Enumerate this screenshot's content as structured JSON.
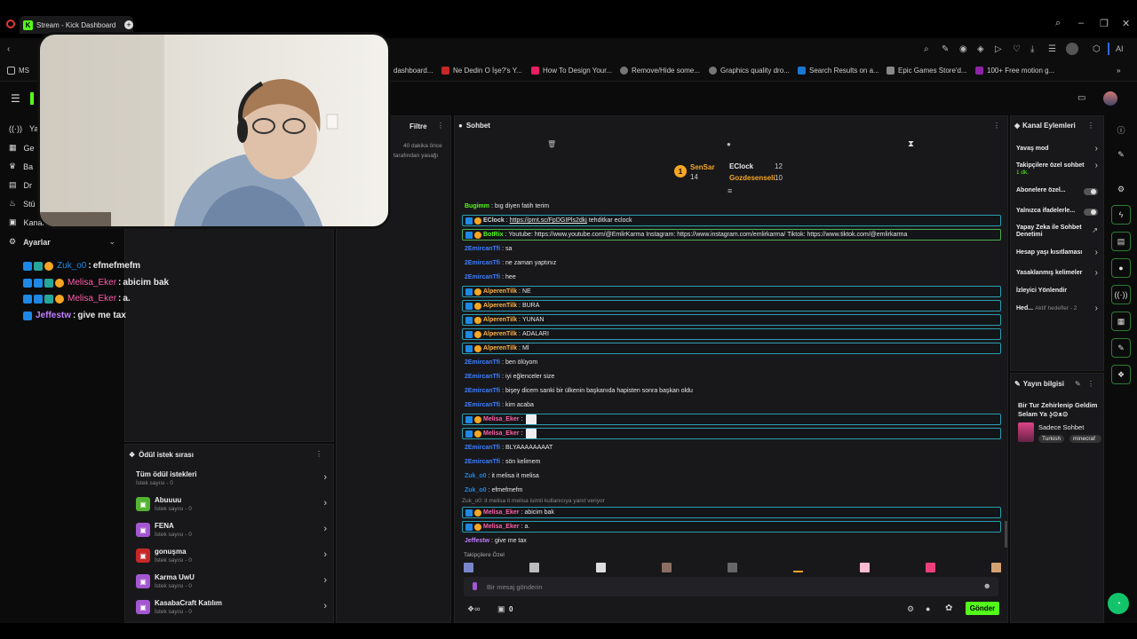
{
  "browser": {
    "tab_title": "Stream - Kick Dashboard",
    "ai_label": "AI"
  },
  "bookmarks": [
    "MS",
    "dashboard...",
    "Ne Dedin O İşe?'s Y...",
    "How To Design Your...",
    "Remove/Hide some...",
    "Graphics quality dro...",
    "Search Results on a...",
    "Epic Games Store'd...",
    "100+ Free motion g..."
  ],
  "left_nav": {
    "items": [
      "Ya",
      "Ge",
      "Ba",
      "Dr",
      "Stü",
      "Kanal"
    ],
    "settings": "Ayarlar"
  },
  "overlay": [
    {
      "user": "Zuk_o0",
      "text": "efmefmefm",
      "color": "#1e88e5"
    },
    {
      "user": "Melisa_Eker",
      "text": "abicim bak",
      "color": "#ff5ea8"
    },
    {
      "user": "Melisa_Eker",
      "text": "a.",
      "color": "#ff5ea8"
    },
    {
      "user": "Jeffestw",
      "text": "give me tax",
      "color": "#c27cff"
    }
  ],
  "filter": {
    "title": "Filtre",
    "time": "40 dakika önce",
    "note": "tarafından yasağı"
  },
  "reward": {
    "title": "Ödül istek sırası",
    "items": [
      {
        "name": "Tüm ödül istekleri",
        "sub": "İstek sayısı - 0",
        "color": ""
      },
      {
        "name": "Abuuuu",
        "sub": "İstek sayısı - 0",
        "color": "#53b332"
      },
      {
        "name": "FENA",
        "sub": "İstek sayısı - 0",
        "color": "#a457d1"
      },
      {
        "name": "gonuşma",
        "sub": "İstek sayısı - 0",
        "color": "#c62828"
      },
      {
        "name": "Karma UwU",
        "sub": "İstek sayısı - 0",
        "color": "#a457d1"
      },
      {
        "name": "KasabaCraft Katılım",
        "sub": "İstek sayısı - 0",
        "color": "#a457d1"
      }
    ]
  },
  "chat": {
    "title": "Sohbet",
    "leaders": [
      {
        "name": "SenSar",
        "count": "14"
      },
      {
        "name": "EClock",
        "count": "12"
      },
      {
        "name": "Gozdesenseli",
        "count": "10"
      }
    ],
    "messages": [
      {
        "user": "Bugimm",
        "text": "bıg diyen fatih terim",
        "color": "#53fc18",
        "style": ""
      },
      {
        "user": "EClock",
        "text": "tehditkar eclock",
        "link": "https://prnt.sc/FpDGIPls2dkj",
        "color": "#d9d9d9",
        "style": "box"
      },
      {
        "user": "BotRix",
        "text": "Youtube: https://www.youtube.com/@EmlirKarma Instagram: https://www.instagram.com/emlirkarma/ Tiktok: https://www.tiktok.com/@emlirkarma",
        "color": "#53fc18",
        "style": "green"
      },
      {
        "user": "2EmircanTfi",
        "text": "sa",
        "color": "#3d7fff",
        "style": ""
      },
      {
        "user": "2EmircanTfi",
        "text": "ne zaman yaptınız",
        "color": "#3d7fff",
        "style": ""
      },
      {
        "user": "2EmircanTfi",
        "text": "hee",
        "color": "#3d7fff",
        "style": ""
      },
      {
        "user": "AlperenTilk",
        "text": "NE",
        "color": "#ffb347",
        "style": "box"
      },
      {
        "user": "AlperenTilk",
        "text": "BURA",
        "color": "#ffb347",
        "style": "box"
      },
      {
        "user": "AlperenTilk",
        "text": "YUNAN",
        "color": "#ffb347",
        "style": "box"
      },
      {
        "user": "AlperenTilk",
        "text": "ADALARI",
        "color": "#ffb347",
        "style": "box"
      },
      {
        "user": "AlperenTilk",
        "text": "Mİ",
        "color": "#ffb347",
        "style": "box"
      },
      {
        "user": "2EmircanTfi",
        "text": "ben ölüyom",
        "color": "#3d7fff",
        "style": ""
      },
      {
        "user": "2EmircanTfi",
        "text": "iyi eğlenceler size",
        "color": "#3d7fff",
        "style": ""
      },
      {
        "user": "2EmircanTfi",
        "text": "bişey dicem sanki bir ülkenin başkanıda hapisten sonra başkan oldu",
        "color": "#3d7fff",
        "style": ""
      },
      {
        "user": "2EmircanTfi",
        "text": "kim acaba",
        "color": "#3d7fff",
        "style": ""
      },
      {
        "user": "Melisa_Eker",
        "text": "",
        "color": "#ff5ea8",
        "style": "box"
      },
      {
        "user": "Melisa_Eker",
        "text": "",
        "color": "#ff5ea8",
        "style": "box"
      },
      {
        "user": "2EmircanTfi",
        "text": "BLYAAAAAAAAT",
        "color": "#3d7fff",
        "style": ""
      },
      {
        "user": "2EmircanTfi",
        "text": "sön kelimem",
        "color": "#3d7fff",
        "style": ""
      },
      {
        "user": "Zuk_o0",
        "text": "it melisa it melisa",
        "color": "#1e88e5",
        "style": ""
      },
      {
        "user": "Zuk_o0",
        "text": "efmefmefm",
        "color": "#1e88e5",
        "style": ""
      }
    ],
    "reply_hint": "Zuk_o0: it melisa it melisa isimli kullanıcıya yanıt veriyor",
    "tail": [
      {
        "user": "Melisa_Eker",
        "text": "abicim bak",
        "color": "#ff5ea8",
        "style": "box"
      },
      {
        "user": "Melisa_Eker",
        "text": "a.",
        "color": "#ff5ea8",
        "style": "box"
      },
      {
        "user": "Jeffestw",
        "text": "give me tax",
        "color": "#c27cff",
        "style": ""
      }
    ],
    "emote_label": "Takipçilere Özel",
    "input_placeholder": "Bir mesaj gönderin",
    "counter": "0",
    "send": "Gönder"
  },
  "channel": {
    "title": "Kanal Eylemleri",
    "items": [
      {
        "label": "Yavaş mod",
        "kind": "arrow",
        "sub": ""
      },
      {
        "label": "Takipçilere özel sohbet",
        "kind": "arrow",
        "sub": "1 dk."
      },
      {
        "label": "Abonelere özel...",
        "kind": "toggle",
        "sub": ""
      },
      {
        "label": "Yalnızca ifadelerle...",
        "kind": "toggle",
        "sub": ""
      },
      {
        "label": "Yapay Zeka ile Sohbet Denetimi",
        "kind": "ext",
        "sub": ""
      },
      {
        "label": "Hesap yaşı kısıtlaması",
        "kind": "arrow",
        "sub": ""
      },
      {
        "label": "Yasaklanmış kelimeler",
        "kind": "arrow",
        "sub": ""
      },
      {
        "label": "İzleyici Yönlendir",
        "kind": "none",
        "sub": ""
      },
      {
        "label": "Hed...",
        "kind": "arrow",
        "sub": "Aktif hedefler - 2"
      }
    ]
  },
  "stream_info": {
    "title": "Yayın bilgisi",
    "stream_title": "Bir Tur Zehirlenip Geldim Selam Ya ʖ̯⊙ᴥ⊙",
    "category": "Sadece Sohbet",
    "tags": [
      "Turkish",
      "minecraf"
    ]
  },
  "colors": {
    "kick_green": "#53fc18",
    "teal": "#2c9caf"
  }
}
